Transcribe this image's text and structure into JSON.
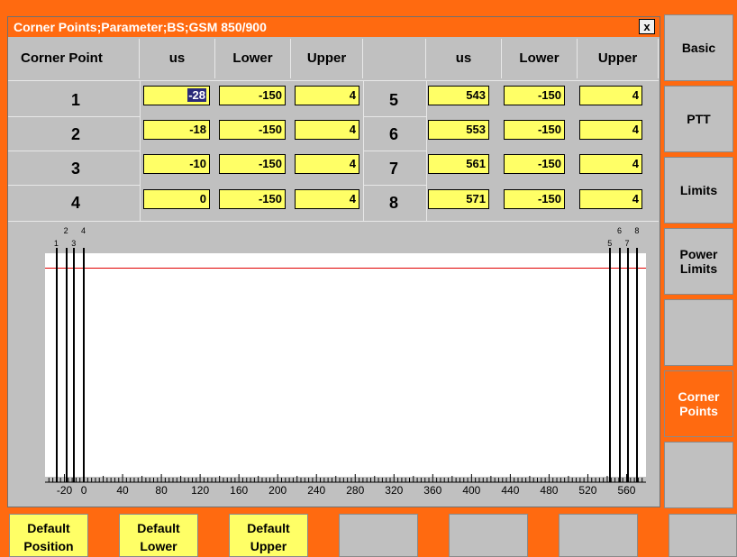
{
  "dialog": {
    "title": "Corner Points;Parameter;BS;GSM 850/900",
    "close_label": "x"
  },
  "table": {
    "corner_point_header": "Corner Point",
    "col_us": "us",
    "col_lower": "Lower",
    "col_upper": "Upper",
    "left_rows": [
      {
        "label": "1",
        "us": "-28",
        "lower": "-150",
        "upper": "4"
      },
      {
        "label": "2",
        "us": "-18",
        "lower": "-150",
        "upper": "4"
      },
      {
        "label": "3",
        "us": "-10",
        "lower": "-150",
        "upper": "4"
      },
      {
        "label": "4",
        "us": "0",
        "lower": "-150",
        "upper": "4"
      }
    ],
    "right_rows": [
      {
        "label": "5",
        "us": "543",
        "lower": "-150",
        "upper": "4"
      },
      {
        "label": "6",
        "us": "553",
        "lower": "-150",
        "upper": "4"
      },
      {
        "label": "7",
        "us": "561",
        "lower": "-150",
        "upper": "4"
      },
      {
        "label": "8",
        "us": "571",
        "lower": "-150",
        "upper": "4"
      }
    ]
  },
  "chart_data": {
    "type": "line",
    "x_ticks": [
      "-20",
      "0",
      "40",
      "80",
      "120",
      "160",
      "200",
      "240",
      "280",
      "320",
      "360",
      "400",
      "440",
      "480",
      "520",
      "560"
    ],
    "xlim": [
      -40,
      580
    ],
    "corner_points": [
      {
        "label": "1",
        "x": -28
      },
      {
        "label": "2",
        "x": -18
      },
      {
        "label": "3",
        "x": -10
      },
      {
        "label": "4",
        "x": 0
      },
      {
        "label": "5",
        "x": 543
      },
      {
        "label": "6",
        "x": 553
      },
      {
        "label": "7",
        "x": 561
      },
      {
        "label": "8",
        "x": 571
      }
    ],
    "limit_color": "#e00000"
  },
  "sidebar": {
    "items": [
      {
        "label": "Basic",
        "active": false
      },
      {
        "label": "PTT",
        "active": false
      },
      {
        "label": "Limits",
        "active": false
      },
      {
        "label": "Power\nLimits",
        "active": false
      },
      {
        "label": "",
        "active": false
      },
      {
        "label": "Corner\nPoints",
        "active": true
      },
      {
        "label": "",
        "active": false
      }
    ]
  },
  "bottom_buttons": [
    {
      "label": "Default\nPosition"
    },
    {
      "label": "Default\nLower"
    },
    {
      "label": "Default\nUpper"
    },
    {
      "label": ""
    },
    {
      "label": ""
    },
    {
      "label": ""
    },
    {
      "label": ""
    }
  ],
  "colors": {
    "accent": "#ff6a10",
    "field": "#ffff66",
    "panel": "#c0c0c0"
  }
}
